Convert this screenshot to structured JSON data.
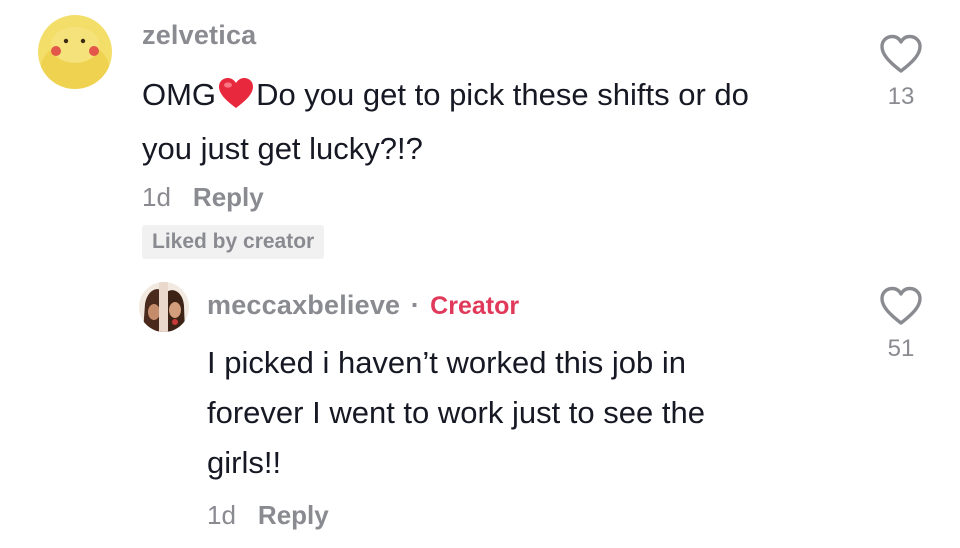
{
  "comment": {
    "username": "zelvetica",
    "text_before": "OMG",
    "emoji": "red-heart",
    "text_line1": "Do you get to pick these shifts or do",
    "text_line2": "you just get lucky?!?",
    "age": "1d",
    "reply_label": "Reply",
    "liked_badge": "Liked by creator",
    "likes": "13"
  },
  "reply": {
    "username": "meccaxbelieve",
    "separator": "·",
    "badge": "Creator",
    "badge_color": "#e0395a",
    "text_line1": "I picked i haven’t worked this job in",
    "text_line2": "forever I went to work just to see the",
    "text_line3": "girls!!",
    "age": "1d",
    "reply_label": "Reply",
    "likes": "51"
  }
}
